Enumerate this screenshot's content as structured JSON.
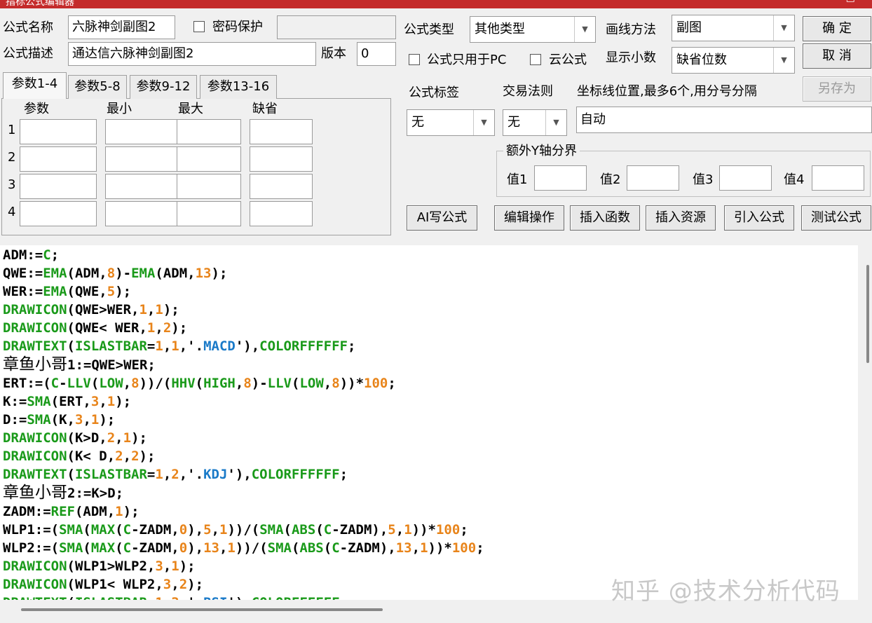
{
  "window": {
    "title": "指标公式编辑器",
    "controls": "□ ✕"
  },
  "header": {
    "name_label": "公式名称",
    "name_value": "六脉神剑副图2",
    "password_label": "密码保护",
    "password_value": "",
    "desc_label": "公式描述",
    "desc_value": "通达信六脉神剑副图2",
    "version_label": "版本",
    "version_value": "0"
  },
  "right": {
    "type_label": "公式类型",
    "type_value": "其他类型",
    "draw_label": "画线方法",
    "draw_value": "副图",
    "pc_only_label": "公式只用于PC",
    "cloud_label": "云公式",
    "decimals_label": "显示小数",
    "decimals_value": "缺省位数",
    "tag_label": "公式标签",
    "tag_value": "无",
    "rule_label": "交易法则",
    "rule_value": "无",
    "coord_label": "坐标线位置,最多6个,用分号分隔",
    "coord_value": "自动",
    "yaxis_label": "额外Y轴分界",
    "v1_label": "值1",
    "v2_label": "值2",
    "v3_label": "值3",
    "v4_label": "值4"
  },
  "buttons": {
    "ok": "确 定",
    "cancel": "取 消",
    "save_as": "另存为",
    "ai": "AI写公式",
    "edit_ops": "编辑操作",
    "insert_func": "插入函数",
    "insert_res": "插入资源",
    "import": "引入公式",
    "test": "测试公式"
  },
  "tabs": [
    "参数1-4",
    "参数5-8",
    "参数9-12",
    "参数13-16"
  ],
  "params": {
    "headers": [
      "参数",
      "最小",
      "最大",
      "缺省"
    ],
    "rows": [
      "1",
      "2",
      "3",
      "4"
    ]
  },
  "code_colors": {
    "plain": "#000000",
    "func": "#1a9a1a",
    "num": "#e8841a",
    "str": "#1a7ac8"
  },
  "code_lines": [
    [
      [
        "p",
        "ADM:="
      ],
      [
        "f",
        "C"
      ],
      [
        "p",
        ";"
      ]
    ],
    [
      [
        "p",
        "QWE:="
      ],
      [
        "f",
        "EMA"
      ],
      [
        "p",
        "(ADM,"
      ],
      [
        "n",
        "8"
      ],
      [
        "p",
        ")-"
      ],
      [
        "f",
        "EMA"
      ],
      [
        "p",
        "(ADM,"
      ],
      [
        "n",
        "13"
      ],
      [
        "p",
        ");"
      ]
    ],
    [
      [
        "p",
        "WER:="
      ],
      [
        "f",
        "EMA"
      ],
      [
        "p",
        "(QWE,"
      ],
      [
        "n",
        "5"
      ],
      [
        "p",
        ");"
      ]
    ],
    [
      [
        "f",
        "DRAWICON"
      ],
      [
        "p",
        "(QWE>WER,"
      ],
      [
        "n",
        "1"
      ],
      [
        "p",
        ","
      ],
      [
        "n",
        "1"
      ],
      [
        "p",
        ");"
      ]
    ],
    [
      [
        "f",
        "DRAWICON"
      ],
      [
        "p",
        "(QWE< WER,"
      ],
      [
        "n",
        "1"
      ],
      [
        "p",
        ","
      ],
      [
        "n",
        "2"
      ],
      [
        "p",
        ");"
      ]
    ],
    [
      [
        "f",
        "DRAWTEXT"
      ],
      [
        "p",
        "("
      ],
      [
        "f",
        "ISLASTBAR"
      ],
      [
        "p",
        "="
      ],
      [
        "n",
        "1"
      ],
      [
        "p",
        ","
      ],
      [
        "n",
        "1"
      ],
      [
        "p",
        ",'."
      ],
      [
        "s",
        "MACD"
      ],
      [
        "p",
        "'),"
      ],
      [
        "f",
        "COLORFFFFFF"
      ],
      [
        "p",
        ";"
      ]
    ],
    [
      [
        "c",
        "章鱼小哥"
      ],
      [
        "p",
        "1:=QWE>WER;"
      ]
    ],
    [
      [
        "p",
        "ERT:=("
      ],
      [
        "f",
        "C"
      ],
      [
        "p",
        "-"
      ],
      [
        "f",
        "LLV"
      ],
      [
        "p",
        "("
      ],
      [
        "f",
        "LOW"
      ],
      [
        "p",
        ","
      ],
      [
        "n",
        "8"
      ],
      [
        "p",
        "))/("
      ],
      [
        "f",
        "HHV"
      ],
      [
        "p",
        "("
      ],
      [
        "f",
        "HIGH"
      ],
      [
        "p",
        ","
      ],
      [
        "n",
        "8"
      ],
      [
        "p",
        ")-"
      ],
      [
        "f",
        "LLV"
      ],
      [
        "p",
        "("
      ],
      [
        "f",
        "LOW"
      ],
      [
        "p",
        ","
      ],
      [
        "n",
        "8"
      ],
      [
        "p",
        "))*"
      ],
      [
        "n",
        "100"
      ],
      [
        "p",
        ";"
      ]
    ],
    [
      [
        "p",
        "K:="
      ],
      [
        "f",
        "SMA"
      ],
      [
        "p",
        "(ERT,"
      ],
      [
        "n",
        "3"
      ],
      [
        "p",
        ","
      ],
      [
        "n",
        "1"
      ],
      [
        "p",
        ");"
      ]
    ],
    [
      [
        "p",
        "D:="
      ],
      [
        "f",
        "SMA"
      ],
      [
        "p",
        "(K,"
      ],
      [
        "n",
        "3"
      ],
      [
        "p",
        ","
      ],
      [
        "n",
        "1"
      ],
      [
        "p",
        ");"
      ]
    ],
    [
      [
        "f",
        "DRAWICON"
      ],
      [
        "p",
        "(K>D,"
      ],
      [
        "n",
        "2"
      ],
      [
        "p",
        ","
      ],
      [
        "n",
        "1"
      ],
      [
        "p",
        ");"
      ]
    ],
    [
      [
        "f",
        "DRAWICON"
      ],
      [
        "p",
        "(K< D,"
      ],
      [
        "n",
        "2"
      ],
      [
        "p",
        ","
      ],
      [
        "n",
        "2"
      ],
      [
        "p",
        ");"
      ]
    ],
    [
      [
        "f",
        "DRAWTEXT"
      ],
      [
        "p",
        "("
      ],
      [
        "f",
        "ISLASTBAR"
      ],
      [
        "p",
        "="
      ],
      [
        "n",
        "1"
      ],
      [
        "p",
        ","
      ],
      [
        "n",
        "2"
      ],
      [
        "p",
        ",'."
      ],
      [
        "s",
        "KDJ"
      ],
      [
        "p",
        "'),"
      ],
      [
        "f",
        "COLORFFFFFF"
      ],
      [
        "p",
        ";"
      ]
    ],
    [
      [
        "c",
        "章鱼小哥"
      ],
      [
        "p",
        "2:=K>D;"
      ]
    ],
    [
      [
        "p",
        "ZADM:="
      ],
      [
        "f",
        "REF"
      ],
      [
        "p",
        "(ADM,"
      ],
      [
        "n",
        "1"
      ],
      [
        "p",
        ");"
      ]
    ],
    [
      [
        "p",
        "WLP1:=("
      ],
      [
        "f",
        "SMA"
      ],
      [
        "p",
        "("
      ],
      [
        "f",
        "MAX"
      ],
      [
        "p",
        "("
      ],
      [
        "f",
        "C"
      ],
      [
        "p",
        "-ZADM,"
      ],
      [
        "n",
        "0"
      ],
      [
        "p",
        "),"
      ],
      [
        "n",
        "5"
      ],
      [
        "p",
        ","
      ],
      [
        "n",
        "1"
      ],
      [
        "p",
        "))/("
      ],
      [
        "f",
        "SMA"
      ],
      [
        "p",
        "("
      ],
      [
        "f",
        "ABS"
      ],
      [
        "p",
        "("
      ],
      [
        "f",
        "C"
      ],
      [
        "p",
        "-ZADM),"
      ],
      [
        "n",
        "5"
      ],
      [
        "p",
        ","
      ],
      [
        "n",
        "1"
      ],
      [
        "p",
        "))*"
      ],
      [
        "n",
        "100"
      ],
      [
        "p",
        ";"
      ]
    ],
    [
      [
        "p",
        "WLP2:=("
      ],
      [
        "f",
        "SMA"
      ],
      [
        "p",
        "("
      ],
      [
        "f",
        "MAX"
      ],
      [
        "p",
        "("
      ],
      [
        "f",
        "C"
      ],
      [
        "p",
        "-ZADM,"
      ],
      [
        "n",
        "0"
      ],
      [
        "p",
        "),"
      ],
      [
        "n",
        "13"
      ],
      [
        "p",
        ","
      ],
      [
        "n",
        "1"
      ],
      [
        "p",
        "))/("
      ],
      [
        "f",
        "SMA"
      ],
      [
        "p",
        "("
      ],
      [
        "f",
        "ABS"
      ],
      [
        "p",
        "("
      ],
      [
        "f",
        "C"
      ],
      [
        "p",
        "-ZADM),"
      ],
      [
        "n",
        "13"
      ],
      [
        "p",
        ","
      ],
      [
        "n",
        "1"
      ],
      [
        "p",
        "))*"
      ],
      [
        "n",
        "100"
      ],
      [
        "p",
        ";"
      ]
    ],
    [
      [
        "f",
        "DRAWICON"
      ],
      [
        "p",
        "(WLP1>WLP2,"
      ],
      [
        "n",
        "3"
      ],
      [
        "p",
        ","
      ],
      [
        "n",
        "1"
      ],
      [
        "p",
        ");"
      ]
    ],
    [
      [
        "f",
        "DRAWICON"
      ],
      [
        "p",
        "(WLP1< WLP2,"
      ],
      [
        "n",
        "3"
      ],
      [
        "p",
        ","
      ],
      [
        "n",
        "2"
      ],
      [
        "p",
        ");"
      ]
    ],
    [
      [
        "f",
        "DRAWTEXT"
      ],
      [
        "p",
        "("
      ],
      [
        "f",
        "ISLASTBAR"
      ],
      [
        "p",
        "="
      ],
      [
        "n",
        "1"
      ],
      [
        "p",
        ","
      ],
      [
        "n",
        "3"
      ],
      [
        "p",
        ",'."
      ],
      [
        "s",
        "RSI"
      ],
      [
        "p",
        "'),"
      ],
      [
        "f",
        "COLORFFFFFF"
      ],
      [
        "p",
        ";"
      ]
    ]
  ],
  "watermark": "知乎 @技术分析代码"
}
